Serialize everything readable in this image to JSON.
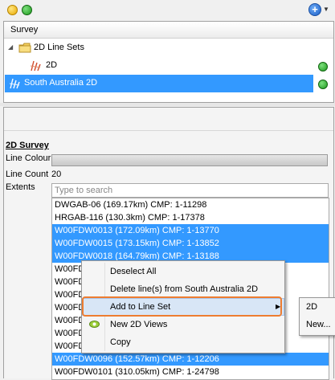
{
  "toolbar": {
    "add_symbol": "+"
  },
  "survey_panel": {
    "header": "Survey",
    "tree": [
      {
        "label": "2D Line Sets",
        "expander": "◢"
      },
      {
        "label": "2D"
      },
      {
        "label": "South Australia 2D"
      }
    ]
  },
  "properties": {
    "section_title": "2D Survey",
    "line_colour_label": "Line Colour",
    "line_count_label": "Line Count",
    "line_count_value": "20",
    "extents_label": "Extents",
    "search_placeholder": "Type to search"
  },
  "lines": [
    {
      "text": "DWGAB-06 (169.17km) CMP: 1-11298",
      "selected": false
    },
    {
      "text": "HRGAB-116 (130.3km) CMP: 1-17378",
      "selected": false
    },
    {
      "text": "W00FDW0013 (172.09km) CMP: 1-13770",
      "selected": true
    },
    {
      "text": "W00FDW0015 (173.15km) CMP: 1-13852",
      "selected": true
    },
    {
      "text": "W00FDW0018 (164.79km) CMP: 1-13188",
      "selected": true
    },
    {
      "text": "W00FD",
      "selected": false
    },
    {
      "text": "W00FD",
      "selected": false
    },
    {
      "text": "W00FD",
      "selected": false
    },
    {
      "text": "W00FD",
      "selected": false
    },
    {
      "text": "W00FD",
      "selected": false
    },
    {
      "text": "W00FD",
      "selected": false
    },
    {
      "text": "W00FD",
      "selected": false
    },
    {
      "text": "W00FDW0096 (152.57km) CMP: 1-12206",
      "selected": true
    },
    {
      "text": "W00FDW0101 (310.05km) CMP: 1-24798",
      "selected": false
    }
  ],
  "context_menu": {
    "items": [
      "Deselect All",
      "Delete line(s) from South Australia 2D",
      "Add to Line Set",
      "New 2D Views",
      "Copy"
    ],
    "submenu_arrow": "▶"
  },
  "submenu": {
    "items": [
      "2D",
      "New..."
    ]
  }
}
